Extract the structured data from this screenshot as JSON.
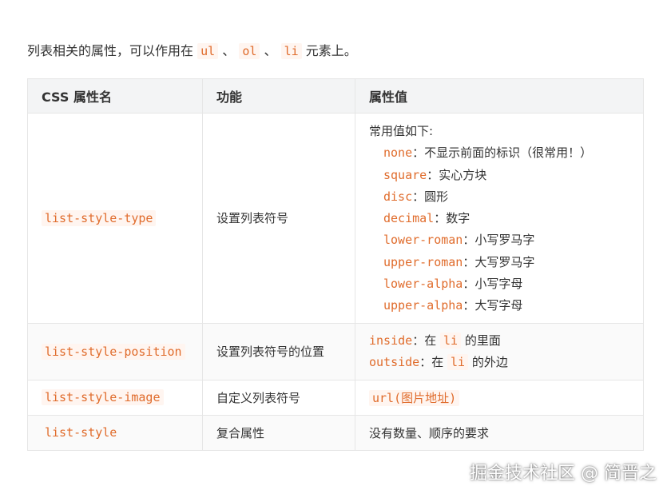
{
  "intro": {
    "text_before": "列表相关的属性，可以作用在",
    "code1": "ul",
    "sep1": "、",
    "code2": "ol",
    "sep2": "、",
    "code3": "li",
    "text_after": "元素上。"
  },
  "table": {
    "headers": [
      "CSS 属性名",
      "功能",
      "属性值"
    ],
    "rows": [
      {
        "name": "list-style-type",
        "func": "设置列表符号",
        "value_head": "常用值如下:",
        "values": [
          {
            "code": "none",
            "desc": "：不显示前面的标识（很常用！）"
          },
          {
            "code": "square",
            "desc": "：实心方块"
          },
          {
            "code": "disc",
            "desc": "：圆形"
          },
          {
            "code": "decimal",
            "desc": "：数字"
          },
          {
            "code": "lower-roman",
            "desc": "：小写罗马字"
          },
          {
            "code": "upper-roman",
            "desc": "：大写罗马字"
          },
          {
            "code": "lower-alpha",
            "desc": "：小写字母"
          },
          {
            "code": "upper-alpha",
            "desc": "：大写字母"
          }
        ]
      },
      {
        "name": "list-style-position",
        "func": "设置列表符号的位置",
        "values": [
          {
            "code": "inside",
            "mid": "：在",
            "code2": "li",
            "desc": "的里面"
          },
          {
            "code": "outside",
            "mid": "：在",
            "code2": "li",
            "desc": "的外边"
          }
        ]
      },
      {
        "name": "list-style-image",
        "func": "自定义列表符号",
        "value_code": "url(图片地址)"
      },
      {
        "name": "list-style",
        "func": "复合属性",
        "value_text": "没有数量、顺序的要求"
      }
    ]
  },
  "watermark": "掘金技术社区 @ 简晋之",
  "colors": {
    "code_text": "#e06c2c",
    "code_bg": "#fff5f0",
    "header_bg": "#f3f4f5",
    "border": "#e6e6e6"
  }
}
